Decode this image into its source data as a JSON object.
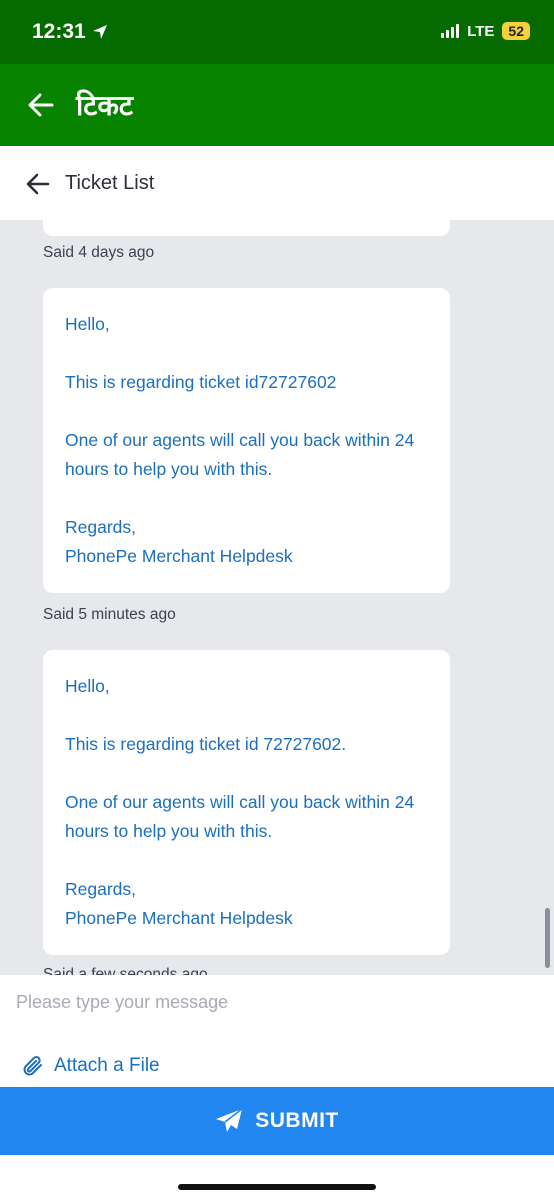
{
  "status_bar": {
    "time": "12:31",
    "network": "LTE",
    "battery": "52"
  },
  "app_bar": {
    "title": "टिकट"
  },
  "sub_header": {
    "title": "Ticket List"
  },
  "messages": [
    {
      "said": "Said 4 days ago"
    },
    {
      "lines": [
        "Hello,",
        "This is regarding ticket id72727602",
        "One of our agents will call you back within 24 hours to help you with this.",
        "Regards,",
        "PhonePe Merchant Helpdesk"
      ],
      "said": "Said 5 minutes ago"
    },
    {
      "lines": [
        "Hello,",
        "This is regarding ticket id 72727602.",
        "One of our agents will call you back within 24 hours to help you with this.",
        "Regards,",
        "PhonePe Merchant Helpdesk"
      ],
      "said": "Said a few seconds ago"
    }
  ],
  "composer": {
    "placeholder": "Please type your message",
    "attach_label": "Attach a File"
  },
  "submit": {
    "label": "SUBMIT"
  },
  "colors": {
    "status_green": "#056b00",
    "app_green": "#078300",
    "accent_blue": "#2186f0",
    "message_blue": "#1a6fbf"
  }
}
